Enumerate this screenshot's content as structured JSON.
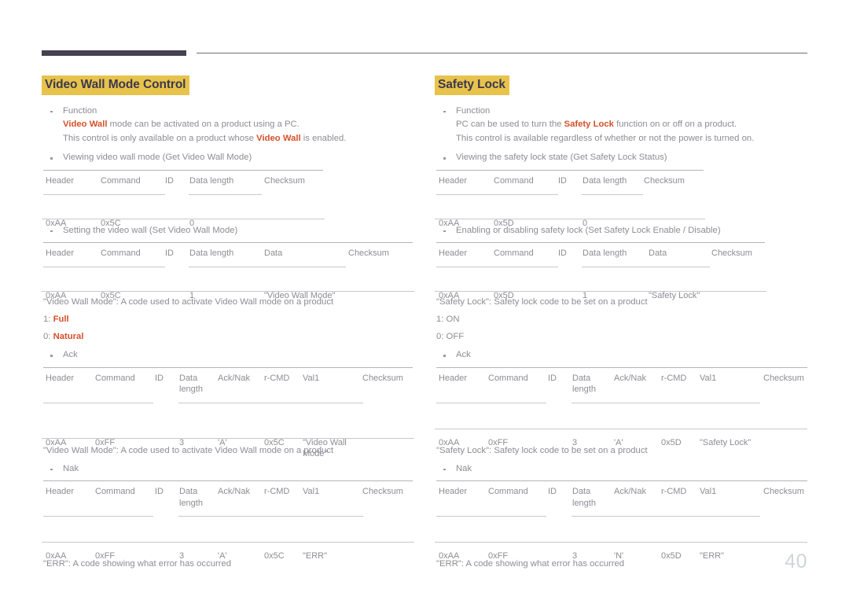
{
  "page": {
    "number": "40"
  },
  "colors": {
    "title_highlight": "#e8c34b",
    "title_text": "#3b3850",
    "accent": "#d4502a",
    "body_text": "#8d8d94",
    "rule_bar": "#45414f",
    "rule_line": "#c8c8cc"
  },
  "left": {
    "title": "Video Wall Mode Control",
    "function_bullet": {
      "label": "Function",
      "line2_pre": "",
      "line2_accent": "Video Wall",
      "line2_post": " mode can be activated on a product using a PC.",
      "line3_pre": "This control is only available on a product whose ",
      "line3_accent": "Video Wall",
      "line3_post": " is enabled."
    },
    "get_bullet": "Viewing video wall mode (Get Video Wall Mode)",
    "get_table": {
      "headers": [
        "Header",
        "Command",
        "ID",
        "Data length",
        "Checksum"
      ],
      "values": [
        "0xAA",
        "0x5C",
        "",
        "0",
        ""
      ]
    },
    "set_bullet": "Setting the video wall (Set Video Wall Mode)",
    "set_table": {
      "headers": [
        "Header",
        "Command",
        "ID",
        "Data length",
        "Data",
        "Checksum"
      ],
      "values": [
        "0xAA",
        "0x5C",
        "",
        "1",
        "\"Video Wall Mode\"",
        ""
      ]
    },
    "note_after_set": "\"Video Wall Mode\": A code used to activate Video Wall mode on a product",
    "option_1_key": "1: ",
    "option_1_val": "Full",
    "option_0_key": "0: ",
    "option_0_val": "Natural",
    "ack_bullet": "Ack",
    "ack_table": {
      "headers": [
        "Header",
        "Command",
        "ID",
        "Data length",
        "Ack/Nak",
        "r-CMD",
        "Val1",
        "Checksum"
      ],
      "values": [
        "0xAA",
        "0xFF",
        "",
        "3",
        "'A'",
        "0x5C",
        "\"Video Wall Mode\"",
        ""
      ]
    },
    "note_after_ack": "\"Video Wall Mode\": A code used to activate Video Wall mode on a product",
    "nak_bullet": "Nak",
    "nak_table": {
      "headers": [
        "Header",
        "Command",
        "ID",
        "Data length",
        "Ack/Nak",
        "r-CMD",
        "Val1",
        "Checksum"
      ],
      "values": [
        "0xAA",
        "0xFF",
        "",
        "3",
        "'A'",
        "0x5C",
        "\"ERR\"",
        ""
      ]
    },
    "note_after_nak": "\"ERR\": A code showing what error has occurred"
  },
  "right": {
    "title": "Safety Lock",
    "function_bullet": {
      "label": "Function",
      "line2_pre": "PC can be used to turn the ",
      "line2_accent": "Safety Lock",
      "line2_post": " function on or off on a product.",
      "line3": "This control is available regardless of whether or not the power is turned on."
    },
    "get_bullet": "Viewing the safety lock state (Get Safety Lock Status)",
    "get_table": {
      "headers": [
        "Header",
        "Command",
        "ID",
        "Data length",
        "Checksum"
      ],
      "values": [
        "0xAA",
        "0x5D",
        "",
        "0",
        ""
      ]
    },
    "set_bullet": "Enabling or disabling safety lock (Set Safety Lock Enable / Disable)",
    "set_table": {
      "headers": [
        "Header",
        "Command",
        "ID",
        "Data length",
        "Data",
        "Checksum"
      ],
      "values": [
        "0xAA",
        "0x5D",
        "",
        "1",
        "\"Safety Lock\"",
        ""
      ]
    },
    "note_after_set": "\"Safety Lock\": Safety lock code to be set on a product",
    "option_1": "1: ON",
    "option_0": "0: OFF",
    "ack_bullet": "Ack",
    "ack_table": {
      "headers": [
        "Header",
        "Command",
        "ID",
        "Data length",
        "Ack/Nak",
        "r-CMD",
        "Val1",
        "Checksum"
      ],
      "values": [
        "0xAA",
        "0xFF",
        "",
        "3",
        "'A'",
        "0x5D",
        "\"Safety Lock\"",
        ""
      ]
    },
    "note_after_ack": "\"Safety Lock\": Safety lock code to be set on a product",
    "nak_bullet": "Nak",
    "nak_table": {
      "headers": [
        "Header",
        "Command",
        "ID",
        "Data length",
        "Ack/Nak",
        "r-CMD",
        "Val1",
        "Checksum"
      ],
      "values": [
        "0xAA",
        "0xFF",
        "",
        "3",
        "'N'",
        "0x5D",
        "\"ERR\"",
        ""
      ]
    },
    "note_after_nak": "\"ERR\": A code showing what error has occurred"
  }
}
